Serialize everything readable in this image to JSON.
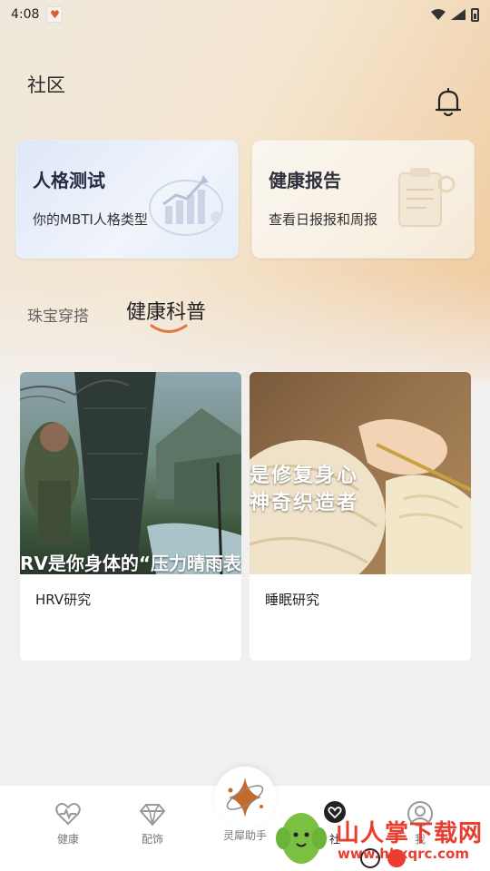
{
  "status_bar": {
    "time": "4:08"
  },
  "header": {
    "title": "社区"
  },
  "cards": [
    {
      "title": "人格测试",
      "subtitle": "你的MBTI人格类型"
    },
    {
      "title": "健康报告",
      "subtitle": "查看日报报和周报"
    }
  ],
  "tabs": [
    {
      "label": "珠宝穿搭",
      "active": false
    },
    {
      "label": "健康科普",
      "active": true
    }
  ],
  "articles": [
    {
      "image_text": "RV是你身体的“压力晴雨表",
      "caption": "HRV研究"
    },
    {
      "image_text_lines": [
        "是修复身心",
        "神奇织造者"
      ],
      "caption": "睡眠研究"
    }
  ],
  "bottom_nav": {
    "items": [
      {
        "label": "健康",
        "icon": "heart-pulse-icon"
      },
      {
        "label": "配饰",
        "icon": "diamond-icon"
      },
      {
        "label": "灵犀助手",
        "icon": "assistant-star-icon"
      },
      {
        "label": "社",
        "icon": "community-heart-icon"
      },
      {
        "label": "我",
        "icon": "profile-icon"
      }
    ]
  },
  "watermark": {
    "text": "山人掌下载网",
    "url": "www.hbxqrc.com"
  },
  "colors": {
    "accent": "#e07a3a",
    "title_dark": "#262a44"
  }
}
